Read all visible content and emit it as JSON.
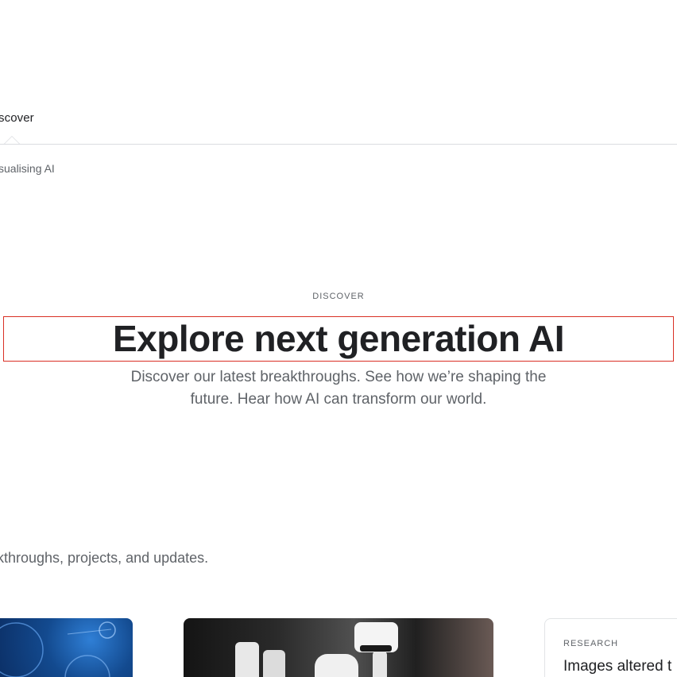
{
  "subnav": {
    "active_tab": "scover",
    "sublink": "sualising AI"
  },
  "hero": {
    "eyebrow": "DISCOVER",
    "title": "Explore next generation AI",
    "description": "Discover our latest breakthroughs. See how we’re shaping the future. Hear how AI can transform our world."
  },
  "section": {
    "intro": "kthroughs, projects, and updates."
  },
  "cards": [
    {
      "image_subject": "blue abstract circles"
    },
    {
      "image_subject": "white robot arm"
    },
    {
      "label": "RESEARCH",
      "title": "Images altered t"
    }
  ]
}
